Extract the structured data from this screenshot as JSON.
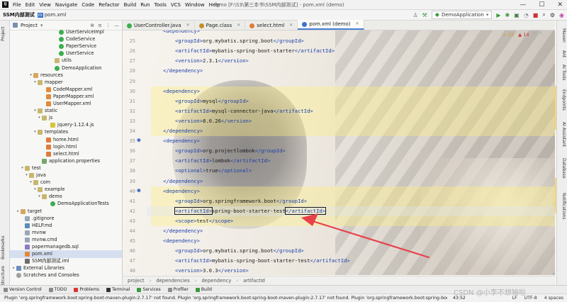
{
  "app": {
    "project_name": "SSM内部测试",
    "current_file": "pom.xml",
    "window_title": "demo [F:\\S3\\第三本书\\SSM内部测试] - pom.xml (demo)"
  },
  "menu": [
    "File",
    "Edit",
    "View",
    "Navigate",
    "Code",
    "Refactor",
    "Build",
    "Run",
    "Tools",
    "VCS",
    "Window",
    "Help"
  ],
  "window_controls": [
    "—",
    "☐",
    "✕"
  ],
  "toolbar_right": {
    "run_config": "DemoApplication",
    "icons": [
      "hammer-icon",
      "run-config-icon",
      "run-icon",
      "debug-icon",
      "coverage-icon",
      "stop-icon",
      "search-icon",
      "settings-icon",
      "jetbrains-icon"
    ]
  },
  "project_panel": {
    "title": "Project",
    "tree": [
      {
        "label": "UserServiceImpl",
        "indent": 10,
        "icon": "java",
        "arrow": ""
      },
      {
        "label": "CodeService",
        "indent": 10,
        "icon": "java",
        "arrow": ""
      },
      {
        "label": "PaperService",
        "indent": 10,
        "icon": "java",
        "arrow": ""
      },
      {
        "label": "UserService",
        "indent": 10,
        "icon": "java",
        "arrow": ""
      },
      {
        "label": "utils",
        "indent": 9,
        "icon": "folder",
        "arrow": ""
      },
      {
        "label": "DemoApplication",
        "indent": 9,
        "icon": "java",
        "arrow": ""
      },
      {
        "label": "resources",
        "indent": 4,
        "icon": "folder-orange",
        "arrow": "▾"
      },
      {
        "label": "mapper",
        "indent": 5,
        "icon": "folder",
        "arrow": "▾"
      },
      {
        "label": "CodeMapper.xml",
        "indent": 7,
        "icon": "xml",
        "arrow": ""
      },
      {
        "label": "PaperMapper.xml",
        "indent": 7,
        "icon": "xml",
        "arrow": ""
      },
      {
        "label": "UserMapper.xml",
        "indent": 7,
        "icon": "xml",
        "arrow": ""
      },
      {
        "label": "static",
        "indent": 5,
        "icon": "folder",
        "arrow": "▾"
      },
      {
        "label": "js",
        "indent": 6,
        "icon": "folder",
        "arrow": "▾"
      },
      {
        "label": "jquery-1.12.4.js",
        "indent": 8,
        "icon": "js",
        "arrow": ""
      },
      {
        "label": "templates",
        "indent": 5,
        "icon": "folder",
        "arrow": "▾"
      },
      {
        "label": "home.html",
        "indent": 7,
        "icon": "html",
        "arrow": ""
      },
      {
        "label": "login.html",
        "indent": 7,
        "icon": "html",
        "arrow": ""
      },
      {
        "label": "select.html",
        "indent": 7,
        "icon": "html",
        "arrow": ""
      },
      {
        "label": "application.properties",
        "indent": 6,
        "icon": "props",
        "arrow": ""
      },
      {
        "label": "test",
        "indent": 2,
        "icon": "folder",
        "arrow": "▾"
      },
      {
        "label": "java",
        "indent": 3,
        "icon": "folder",
        "arrow": "▾"
      },
      {
        "label": "com",
        "indent": 4,
        "icon": "folder",
        "arrow": "▾"
      },
      {
        "label": "example",
        "indent": 5,
        "icon": "folder",
        "arrow": "▾"
      },
      {
        "label": "demo",
        "indent": 6,
        "icon": "folder",
        "arrow": "▾"
      },
      {
        "label": "DemoApplicationTests",
        "indent": 8,
        "icon": "java",
        "arrow": ""
      },
      {
        "label": "target",
        "indent": 1,
        "icon": "folder-orange",
        "arrow": "▸"
      },
      {
        "label": ".gitignore",
        "indent": 2,
        "icon": "file",
        "arrow": ""
      },
      {
        "label": "HELP.md",
        "indent": 2,
        "icon": "md",
        "arrow": ""
      },
      {
        "label": "mvnw",
        "indent": 2,
        "icon": "file",
        "arrow": ""
      },
      {
        "label": "mvnw.cmd",
        "indent": 2,
        "icon": "file",
        "arrow": ""
      },
      {
        "label": "papermanagedb.sql",
        "indent": 2,
        "icon": "sql",
        "arrow": ""
      },
      {
        "label": "pom.xml",
        "indent": 2,
        "icon": "xml",
        "arrow": "",
        "selected": true
      },
      {
        "label": "SSM内部测试.iml",
        "indent": 2,
        "icon": "iml",
        "arrow": ""
      },
      {
        "label": "External Libraries",
        "indent": 0,
        "icon": "lib",
        "arrow": "▸"
      },
      {
        "label": "Scratches and Consoles",
        "indent": 0,
        "icon": "scratch",
        "arrow": ""
      }
    ]
  },
  "left_strip_tabs": [
    "Project",
    "Bookmarks",
    "Structure"
  ],
  "editor_tabs": [
    {
      "label": "UserController.java",
      "color": "#3cae4f",
      "active": false
    },
    {
      "label": "Page.class",
      "color": "#c78a2a",
      "active": false
    },
    {
      "label": "select.html",
      "color": "#e07b39",
      "active": false
    },
    {
      "label": "pom.xml (demo)",
      "color": "#3b73c9",
      "active": true
    }
  ],
  "editor": {
    "problems": {
      "warnings": "⚠ 15",
      "errors": "▲ 14"
    },
    "lines": [
      {
        "n": "",
        "ind": 1,
        "parts": [
          [
            "t",
            "<dependency>"
          ]
        ]
      },
      {
        "n": "25",
        "ind": 2,
        "parts": [
          [
            "t",
            "<groupId>"
          ],
          [
            "x",
            "org.mybatis.spring.boot"
          ],
          [
            "t",
            "</groupId>"
          ]
        ]
      },
      {
        "n": "26",
        "ind": 2,
        "parts": [
          [
            "t",
            "<artifactId>"
          ],
          [
            "x",
            "mybatis-spring-boot-starter"
          ],
          [
            "t",
            "</artifactId>"
          ]
        ]
      },
      {
        "n": "27",
        "ind": 2,
        "parts": [
          [
            "t",
            "<version>"
          ],
          [
            "x",
            "2.3.1"
          ],
          [
            "t",
            "</version>"
          ]
        ]
      },
      {
        "n": "28",
        "ind": 1,
        "parts": [
          [
            "t",
            "</dependency>"
          ]
        ]
      },
      {
        "n": "29",
        "ind": 0,
        "parts": []
      },
      {
        "n": "30",
        "ind": 1,
        "parts": [
          [
            "t",
            "<dependency>"
          ]
        ],
        "hl": true
      },
      {
        "n": "31",
        "ind": 2,
        "parts": [
          [
            "t",
            "<groupId>"
          ],
          [
            "x",
            "mysql"
          ],
          [
            "t",
            "</groupId>"
          ]
        ],
        "hl": true
      },
      {
        "n": "32",
        "ind": 2,
        "parts": [
          [
            "t",
            "<artifactId>"
          ],
          [
            "x",
            "mysql-connector-java"
          ],
          [
            "t",
            "</artifactId>"
          ]
        ],
        "hl": true
      },
      {
        "n": "33",
        "ind": 2,
        "parts": [
          [
            "t",
            "<version>"
          ],
          [
            "x",
            "8.0.26"
          ],
          [
            "t",
            "</version>"
          ]
        ],
        "hl": true
      },
      {
        "n": "34",
        "ind": 1,
        "parts": [
          [
            "t",
            "</dependency>"
          ]
        ],
        "hl": true
      },
      {
        "n": "35",
        "ind": 1,
        "parts": [
          [
            "t",
            "<dependency>"
          ]
        ],
        "gutter": true
      },
      {
        "n": "36",
        "ind": 2,
        "parts": [
          [
            "t",
            "<groupId>"
          ],
          [
            "x",
            "org.projectlombok"
          ],
          [
            "t",
            "</groupId>"
          ]
        ]
      },
      {
        "n": "37",
        "ind": 2,
        "parts": [
          [
            "t",
            "<artifactId>"
          ],
          [
            "x",
            "lombok"
          ],
          [
            "t",
            "</artifactId>"
          ]
        ]
      },
      {
        "n": "38",
        "ind": 2,
        "parts": [
          [
            "t",
            "<optional>"
          ],
          [
            "x",
            "true"
          ],
          [
            "t",
            "</optional>"
          ]
        ]
      },
      {
        "n": "39",
        "ind": 1,
        "parts": [
          [
            "t",
            "</dependency>"
          ]
        ]
      },
      {
        "n": "40",
        "ind": 1,
        "parts": [
          [
            "t",
            "<dependency>"
          ]
        ],
        "hl": true,
        "gutter": true
      },
      {
        "n": "41",
        "ind": 2,
        "parts": [
          [
            "t",
            "<groupId>"
          ],
          [
            "x",
            "org.springframework.boot"
          ],
          [
            "t",
            "</groupId>"
          ]
        ],
        "hl": true
      },
      {
        "n": "42",
        "ind": 2,
        "parts": [
          [
            "c",
            "<artifactId>"
          ],
          [
            "x",
            "spring-boot-starter-test"
          ],
          [
            "c",
            "</artifactId>"
          ]
        ],
        "hl": true,
        "current": true
      },
      {
        "n": "43",
        "ind": 2,
        "parts": [
          [
            "t",
            "<scope>"
          ],
          [
            "x",
            "test"
          ],
          [
            "t",
            "</scope>"
          ]
        ],
        "hl": true
      },
      {
        "n": "44",
        "ind": 1,
        "parts": [
          [
            "t",
            "</dependency>"
          ]
        ]
      },
      {
        "n": "45",
        "ind": 1,
        "parts": [
          [
            "t",
            "<dependency>"
          ]
        ]
      },
      {
        "n": "46",
        "ind": 2,
        "parts": [
          [
            "t",
            "<groupId>"
          ],
          [
            "x",
            "org.mybatis.spring.boot"
          ],
          [
            "t",
            "</groupId>"
          ]
        ]
      },
      {
        "n": "47",
        "ind": 2,
        "parts": [
          [
            "t",
            "<artifactId>"
          ],
          [
            "x",
            "mybatis-spring-boot-starter-test"
          ],
          [
            "t",
            "</artifactId>"
          ]
        ]
      },
      {
        "n": "48",
        "ind": 2,
        "parts": [
          [
            "t",
            "<version>"
          ],
          [
            "x",
            "3.0.3"
          ],
          [
            "t",
            "</version>"
          ]
        ]
      }
    ]
  },
  "right_strip_tabs": [
    "Maven",
    "Ant",
    "AI Tools",
    "Endpoints",
    "AI Assistant",
    "Database",
    "Notifications"
  ],
  "breadcrumbs": [
    "project",
    "dependencies",
    "dependency",
    "artifactId"
  ],
  "bottom_tabs": [
    "Version Control",
    "TODO",
    "Problems",
    "Terminal",
    "Services",
    "Profiler",
    "Build"
  ],
  "statusbar": {
    "message": "Plugin 'org.springframework.boot:spring-boot-maven-plugin:2.7.17' not found. Plugin 'org.springframework.boot:spring-boot-maven-plugin:2.7.17' not found. Plugin 'org.springframework.boot:spring-boot-",
    "position": "43:52",
    "line_sep": "LF",
    "encoding": "UTF-8",
    "indent": "4 spaces"
  },
  "watermark": "CSDN @小李不想输啦",
  "colors": {
    "accent": "#4a7fd1",
    "xml_tag": "#1c3fa8",
    "highlight": "#fff0a0",
    "arrow": "#e8414b"
  }
}
